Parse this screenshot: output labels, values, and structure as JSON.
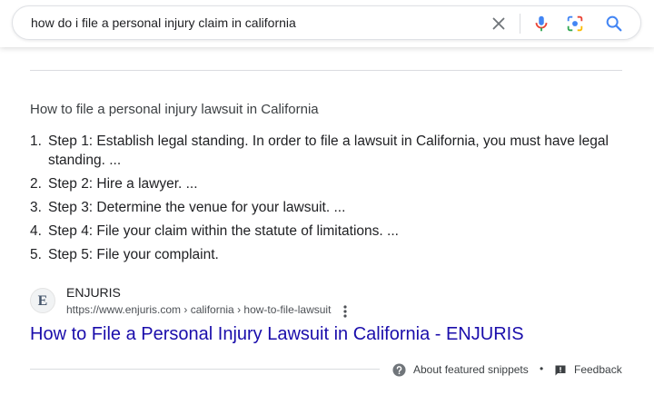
{
  "search": {
    "query": "how do i file a personal injury claim in california"
  },
  "snippet": {
    "heading": "How to file a personal injury lawsuit in California",
    "steps": [
      {
        "num": "1.",
        "text": "Step 1: Establish legal standing. In order to file a lawsuit in California, you must have legal standing. ..."
      },
      {
        "num": "2.",
        "text": "Step 2: Hire a lawyer. ..."
      },
      {
        "num": "3.",
        "text": "Step 3: Determine the venue for your lawsuit. ..."
      },
      {
        "num": "4.",
        "text": "Step 4: File your claim within the statute of limitations. ..."
      },
      {
        "num": "5.",
        "text": "Step 5: File your complaint."
      }
    ]
  },
  "source": {
    "favicon_letter": "E",
    "site_name": "ENJURIS",
    "url": "https://www.enjuris.com › california › how-to-file-lawsuit",
    "title": "How to File a Personal Injury Lawsuit in California - ENJURIS"
  },
  "footer": {
    "about_label": "About featured snippets",
    "separator": "•",
    "feedback_label": "Feedback"
  },
  "colors": {
    "link": "#1a0dab",
    "text": "#202124",
    "secondary_text": "#4d5156",
    "accent_blue": "#4285f4"
  },
  "icons": [
    "clear-icon",
    "mic-icon",
    "lens-icon",
    "search-icon",
    "more-options-icon",
    "help-icon",
    "feedback-icon"
  ]
}
